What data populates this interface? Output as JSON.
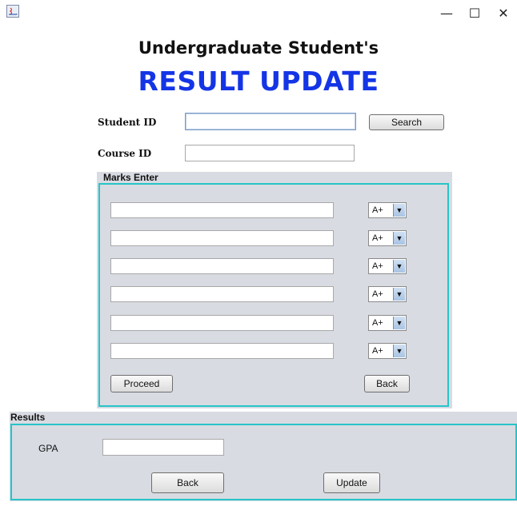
{
  "window": {
    "minimize_glyph": "—",
    "maximize_glyph": "☐",
    "close_glyph": "✕"
  },
  "header": {
    "title_line1": "Undergraduate Student's",
    "title_line2": "RESULT UPDATE"
  },
  "form": {
    "student_id_label": "Student ID",
    "student_id_value": "",
    "search_label": "Search",
    "course_id_label": "Course ID",
    "course_id_value": ""
  },
  "marks_panel": {
    "title": "Marks Enter",
    "rows": [
      {
        "mark": "",
        "grade": "A+"
      },
      {
        "mark": "",
        "grade": "A+"
      },
      {
        "mark": "",
        "grade": "A+"
      },
      {
        "mark": "",
        "grade": "A+"
      },
      {
        "mark": "",
        "grade": "A+"
      },
      {
        "mark": "",
        "grade": "A+"
      }
    ],
    "dropdown_arrow": "▼",
    "proceed_label": "Proceed",
    "back_label": "Back"
  },
  "results_panel": {
    "title": "Results",
    "gpa_label": "GPA",
    "gpa_value": "",
    "back_label": "Back",
    "update_label": "Update"
  },
  "colors": {
    "accent_title": "#1435e6",
    "panel_border": "#27c4c9",
    "panel_bg": "#d8dbe2"
  }
}
